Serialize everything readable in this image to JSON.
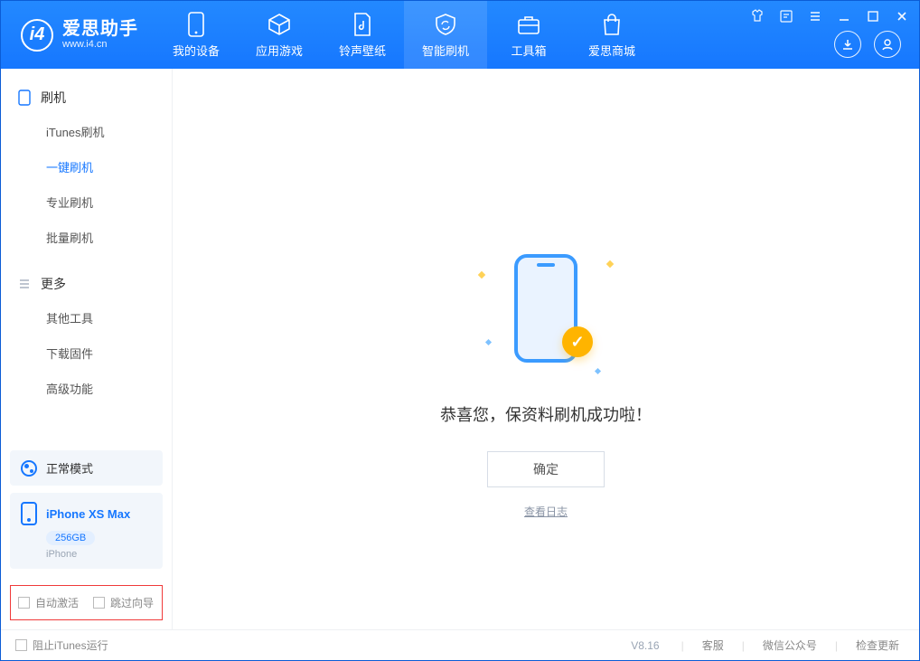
{
  "brand": {
    "title": "爱思助手",
    "subtitle": "www.i4.cn"
  },
  "nav": {
    "device": "我的设备",
    "apps": "应用游戏",
    "ring": "铃声壁纸",
    "flash": "智能刷机",
    "toolbox": "工具箱",
    "store": "爱思商城"
  },
  "sidebar": {
    "group_flash": "刷机",
    "items_flash": {
      "itunes": "iTunes刷机",
      "oneclick": "一键刷机",
      "pro": "专业刷机",
      "batch": "批量刷机"
    },
    "group_more": "更多",
    "items_more": {
      "other": "其他工具",
      "firmware": "下载固件",
      "advanced": "高级功能"
    }
  },
  "status": {
    "mode": "正常模式",
    "device_name": "iPhone XS Max",
    "capacity": "256GB",
    "device_type": "iPhone"
  },
  "options": {
    "auto_activate": "自动激活",
    "skip_guide": "跳过向导"
  },
  "main": {
    "success": "恭喜您，保资料刷机成功啦！",
    "ok": "确定",
    "view_log": "查看日志"
  },
  "footer": {
    "block_itunes": "阻止iTunes运行",
    "version": "V8.16",
    "support": "客服",
    "wechat": "微信公众号",
    "update": "检查更新"
  }
}
